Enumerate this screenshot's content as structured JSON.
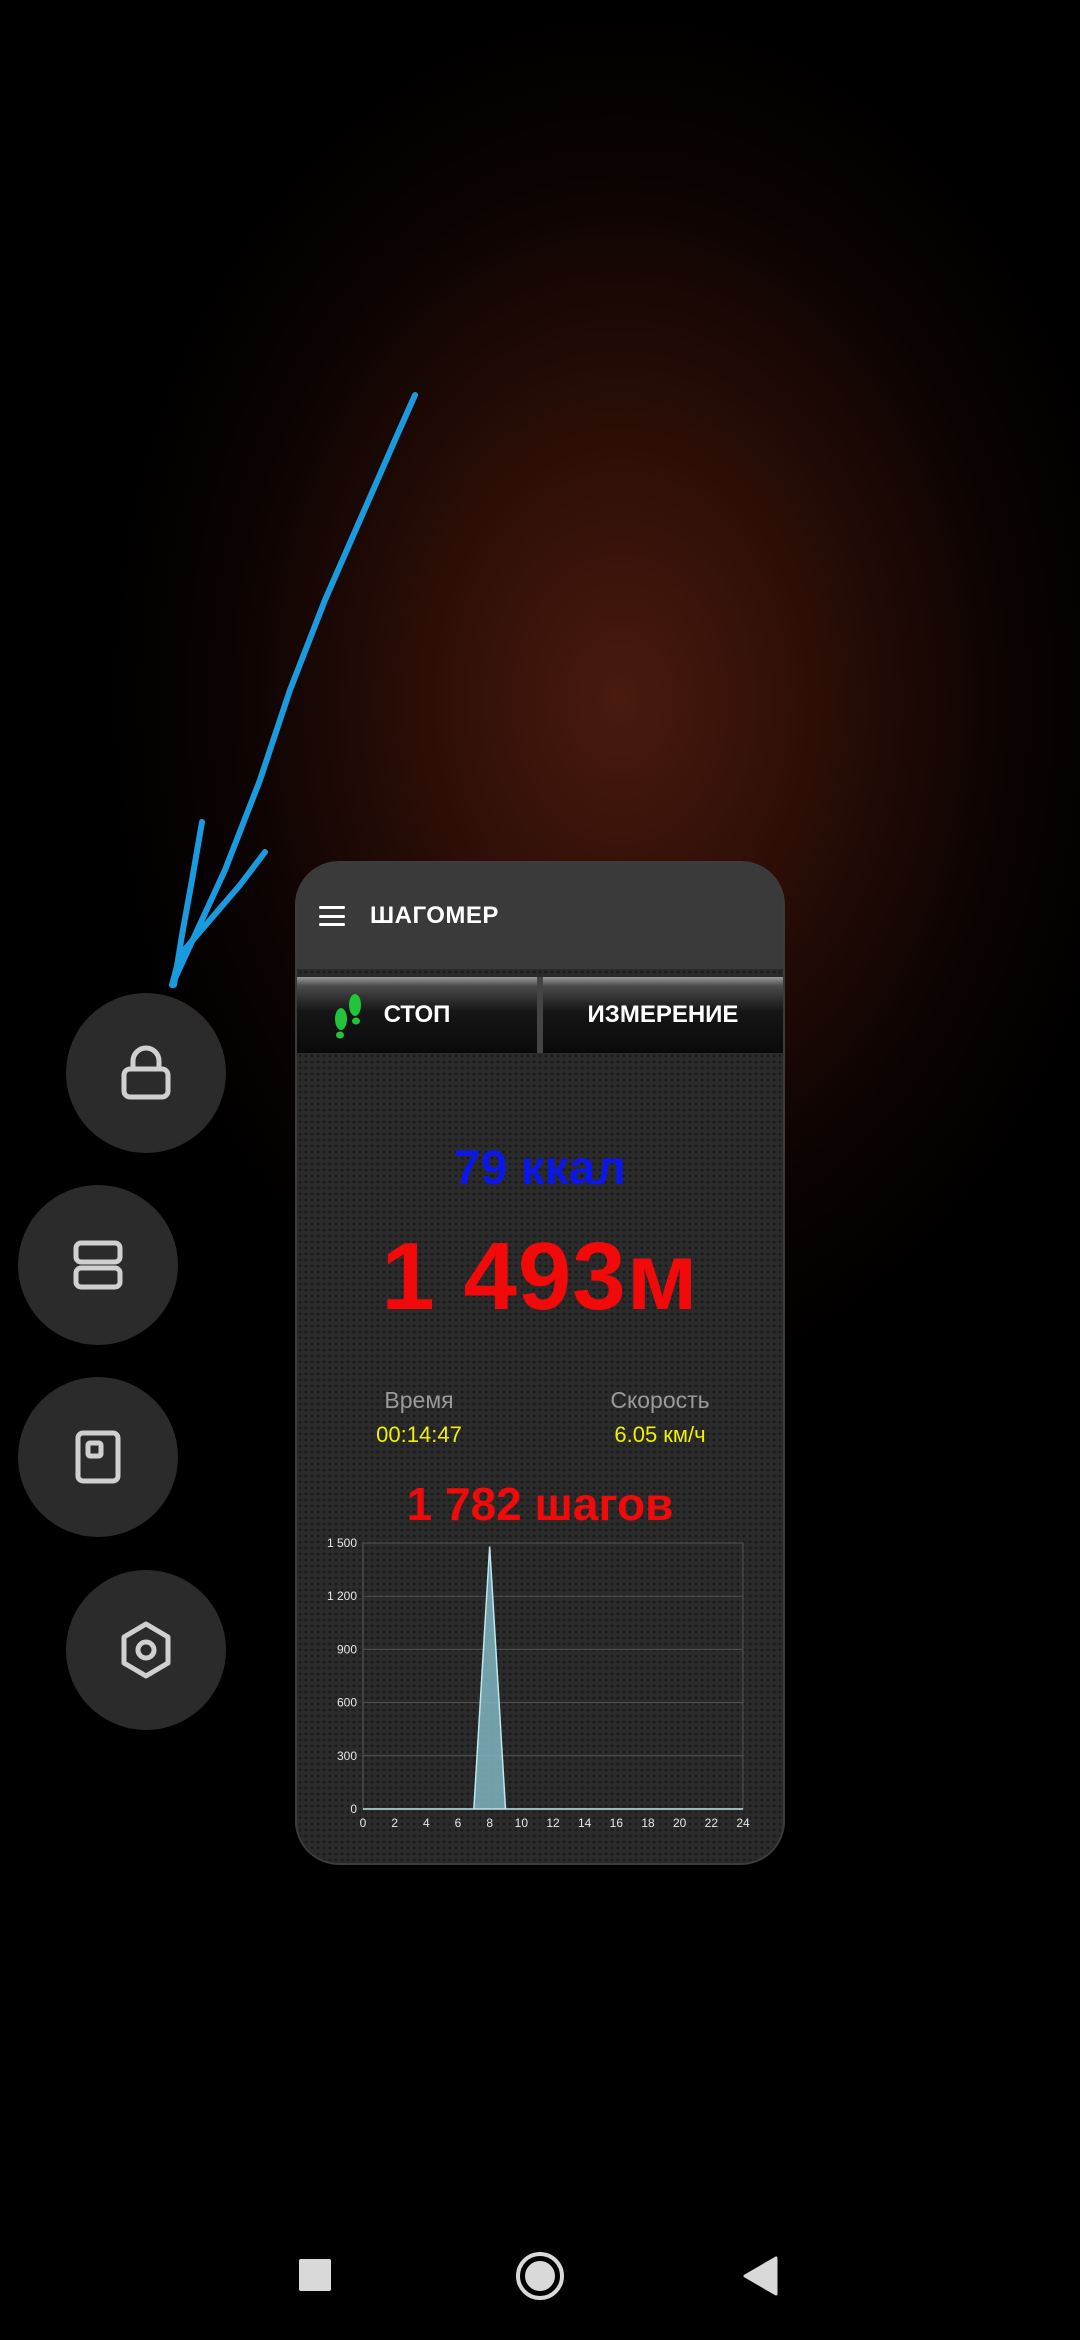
{
  "app": {
    "title": "ШАГОМЕР",
    "stop_label": "СТОП",
    "measure_label": "ИЗМЕРЕНИЕ",
    "kcal": "79 ккал",
    "distance": "1 493м",
    "time_label": "Время",
    "time_value": "00:14:47",
    "speed_label": "Скорость",
    "speed_value": "6.05 км/ч",
    "steps": "1 782 шагов"
  },
  "side_buttons": [
    {
      "icon": "lock-icon"
    },
    {
      "icon": "split-screen-icon"
    },
    {
      "icon": "floating-window-icon"
    },
    {
      "icon": "settings-icon"
    }
  ],
  "nav_bar": {
    "recents_icon": "square-icon",
    "home_icon": "circle-icon",
    "back_icon": "triangle-back-icon"
  },
  "colors": {
    "kcal": "#0a17e6",
    "distance": "#f20a0a",
    "values": "#f0f000",
    "chart_fill": "#7fb6c2",
    "annotation_arrow": "#1a9be0"
  },
  "chart_data": {
    "type": "area",
    "x": [
      0,
      7,
      8,
      9,
      24
    ],
    "values": [
      0,
      0,
      1480,
      0,
      0
    ],
    "x_ticks": [
      "0",
      "2",
      "4",
      "6",
      "8",
      "10",
      "12",
      "14",
      "16",
      "18",
      "20",
      "22",
      "24"
    ],
    "y_ticks": [
      "0",
      "300",
      "600",
      "900",
      "1 200",
      "1 500"
    ],
    "xlim": [
      0,
      24
    ],
    "ylim": [
      0,
      1500
    ],
    "grid": true
  }
}
